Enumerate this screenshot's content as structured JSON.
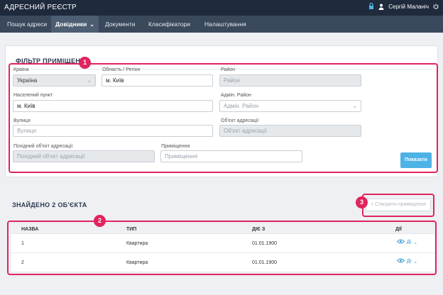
{
  "header": {
    "app_title": "АДРЕСНИЙ РЕЄСТР",
    "user_name": "Сергій Маланіч"
  },
  "nav": {
    "items": [
      {
        "label": "Пошук адреси"
      },
      {
        "label": "Довідники"
      },
      {
        "label": "Документи"
      },
      {
        "label": "Класифікатори"
      },
      {
        "label": "Налаштування"
      }
    ],
    "active": "Довідники"
  },
  "filter": {
    "title": "ФІЛЬТР ПРИМІЩЕНЬ",
    "country": {
      "label": "Країна",
      "value": "Україна"
    },
    "region": {
      "label": "Область / Регіон",
      "value": "м. Київ"
    },
    "district": {
      "label": "Район",
      "placeholder": "Район"
    },
    "locality": {
      "label": "Населений пункт",
      "value": "м. Київ"
    },
    "admin_district": {
      "label": "Адмін. Район",
      "placeholder": "Адмін. Район"
    },
    "street": {
      "label": "Вулиця",
      "placeholder": "Вулиця"
    },
    "address_object": {
      "label": "Об'єкт адресації",
      "placeholder": "Об'єкт адресації"
    },
    "derived_object": {
      "label": "Похідний об'єкт адресації",
      "placeholder": "Похідний об'єкт адресації"
    },
    "premises": {
      "label": "Приміщення",
      "placeholder": "Приміщення"
    },
    "show_button": "Показати"
  },
  "results": {
    "title": "ЗНАЙДЕНО 2 ОБ'ЄКТА",
    "create_button": "+ Створити приміщення",
    "columns": [
      "НАЗВА",
      "ТИП",
      "ДІЄ З",
      "ДІЇ"
    ],
    "rows": [
      {
        "name": "1",
        "type": "Квартира",
        "since": "01.01.1900",
        "action": "Ді"
      },
      {
        "name": "2",
        "type": "Квартира",
        "since": "01.01.1900",
        "action": "Ді"
      }
    ]
  },
  "annotations": [
    "1",
    "2",
    "3"
  ],
  "colors": {
    "topbar": "#1f2a3c",
    "navbar": "#39485b",
    "accent": "#4db3e6",
    "highlight": "#e0245e"
  }
}
